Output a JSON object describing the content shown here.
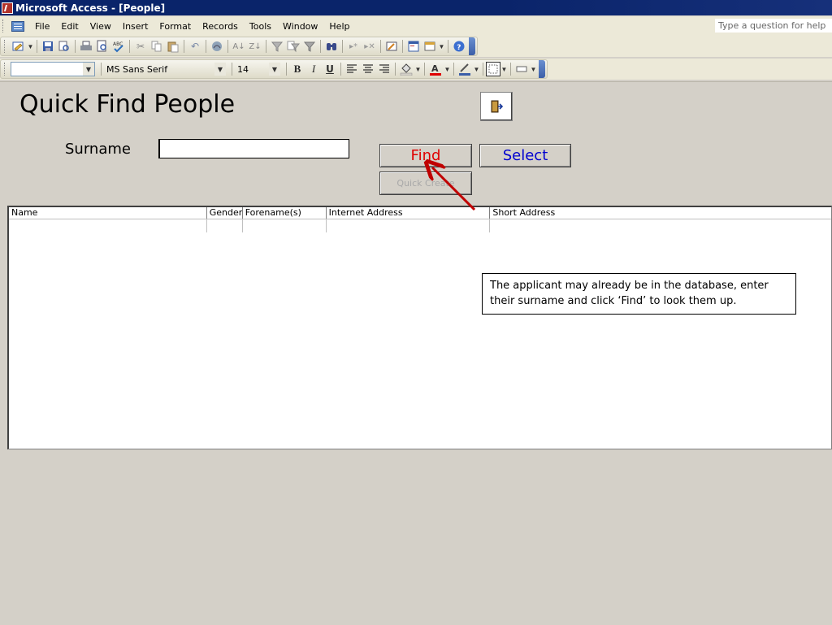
{
  "window": {
    "title": "Microsoft Access - [People]"
  },
  "menubar": {
    "items": [
      {
        "label": "File"
      },
      {
        "label": "Edit"
      },
      {
        "label": "View"
      },
      {
        "label": "Insert"
      },
      {
        "label": "Format"
      },
      {
        "label": "Records"
      },
      {
        "label": "Tools"
      },
      {
        "label": "Window"
      },
      {
        "label": "Help"
      }
    ],
    "help_placeholder": "Type a question for help"
  },
  "format_toolbar": {
    "object_combo": "",
    "font_combo": "MS Sans Serif",
    "size_combo": "14",
    "bold": "B",
    "italic": "I",
    "underline": "U"
  },
  "form": {
    "title": "Quick Find People",
    "surname_label": "Surname",
    "surname_value": "",
    "find_label": "Find",
    "select_label": "Select",
    "quick_create_label": "Quick Create"
  },
  "list": {
    "columns": [
      "Name",
      "Gender",
      "Forename(s)",
      "Internet Address",
      "Short Address"
    ]
  },
  "callout": {
    "text": "The applicant may already be in the database, enter their surname and click ‘Find’ to look them up."
  },
  "colors": {
    "title_bar": "#0a246a",
    "find_text": "#e00000",
    "select_text": "#0000d0",
    "annotation_arrow": "#c00000"
  }
}
